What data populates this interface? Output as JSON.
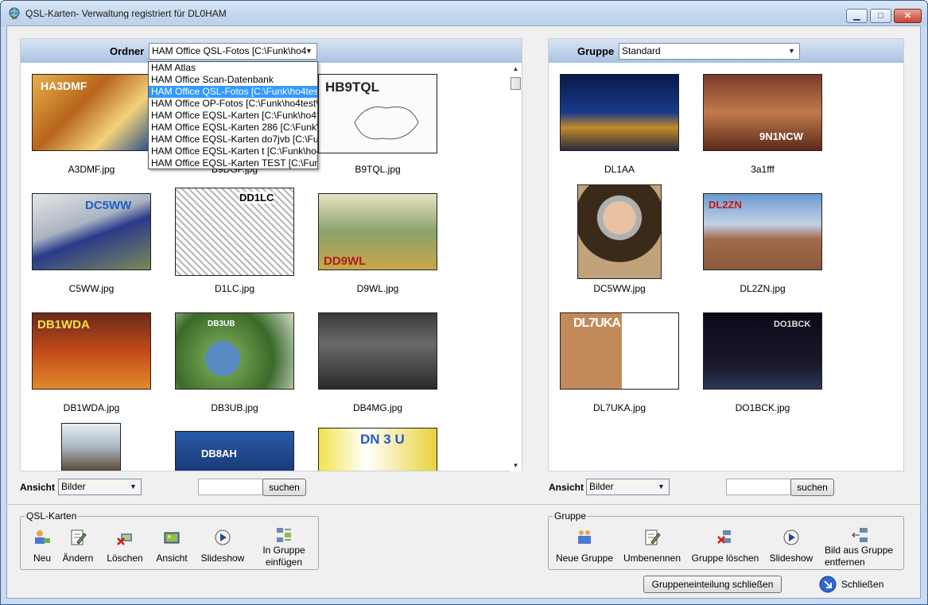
{
  "window": {
    "title": "QSL-Karten- Verwaltung  registriert für DL0HAM",
    "min_label": "▁",
    "max_label": "□",
    "close_label": "✕"
  },
  "left": {
    "header_label": "Ordner",
    "folder_value": "HAM Office QSL-Fotos [C:\\Funk\\ho4",
    "dropdown": [
      "HAM Atlas",
      "HAM Office Scan-Datenbank",
      "HAM Office QSL-Fotos [C:\\Funk\\ho4tes",
      "HAM Office OP-Fotos [C:\\Funk\\ho4test\\",
      "HAM Office EQSL-Karten [C:\\Funk\\ho4f",
      "HAM Office EQSL-Karten 286 [C:\\Funk\\",
      "HAM Office EQSL-Karten do7jvb [C:\\Fu",
      "HAM Office EQSL-Karten t [C:\\Funk\\ho4",
      "HAM Office EQSL-Karten TEST [C:\\Funk"
    ],
    "tiles": [
      {
        "name": "A3DMF.jpg",
        "text": "HA3DMF"
      },
      {
        "name": "B9DGF.jpg",
        "text": ""
      },
      {
        "name": "B9TQL.jpg",
        "text": "HB9TQL"
      },
      {
        "name": "C5WW.jpg",
        "text": "DC5WW"
      },
      {
        "name": "D1LC.jpg",
        "text": "DD1LC"
      },
      {
        "name": "D9WL.jpg",
        "text": "DD9WL"
      },
      {
        "name": "DB1WDA.jpg",
        "text": "DB1WDA"
      },
      {
        "name": "DB3UB.jpg",
        "text": "DB3UB"
      },
      {
        "name": "DB4MG.jpg",
        "text": ""
      },
      {
        "name": "",
        "text": ""
      },
      {
        "name": "",
        "text": "DB8AH"
      },
      {
        "name": "",
        "text": "DN 3 U"
      }
    ],
    "view_label": "Ansicht",
    "view_value": "Bilder",
    "search_button": "suchen"
  },
  "right": {
    "header_label": "Gruppe",
    "group_value": "Standard",
    "tiles": [
      {
        "name": "DL1AA",
        "text": ""
      },
      {
        "name": "3a1fff",
        "text": "9N1NCW"
      },
      {
        "name": "DC5WW.jpg",
        "text": ""
      },
      {
        "name": "DL2ZN.jpg",
        "text": "DL2ZN"
      },
      {
        "name": "DL7UKA.jpg",
        "text": "DL7UKA"
      },
      {
        "name": "DO1BCK.jpg",
        "text": "DO1BCK"
      }
    ],
    "view_label": "Ansicht",
    "view_value": "Bilder",
    "search_button": "suchen"
  },
  "qsl_group": {
    "title": "QSL-Karten",
    "tools": [
      {
        "label": "Neu",
        "icon": "new-card-icon"
      },
      {
        "label": "Ändern",
        "icon": "edit-icon"
      },
      {
        "label": "Löschen",
        "icon": "delete-icon"
      },
      {
        "label": "Ansicht",
        "icon": "view-icon"
      },
      {
        "label": "Slideshow",
        "icon": "play-icon"
      },
      {
        "label": "In Gruppe einfügen",
        "icon": "insert-group-icon"
      }
    ]
  },
  "group_group": {
    "title": "Gruppe",
    "tools": [
      {
        "label": "Neue Gruppe",
        "icon": "new-group-icon"
      },
      {
        "label": "Umbenennen",
        "icon": "rename-icon"
      },
      {
        "label": "Gruppe löschen",
        "icon": "delete-group-icon"
      },
      {
        "label": "Slideshow",
        "icon": "play-icon"
      },
      {
        "label": "Bild aus Gruppe entfernen",
        "icon": "remove-from-group-icon"
      }
    ]
  },
  "footer": {
    "close_group_button": "Gruppeneinteilung schließen",
    "close_button": "Schließen"
  }
}
